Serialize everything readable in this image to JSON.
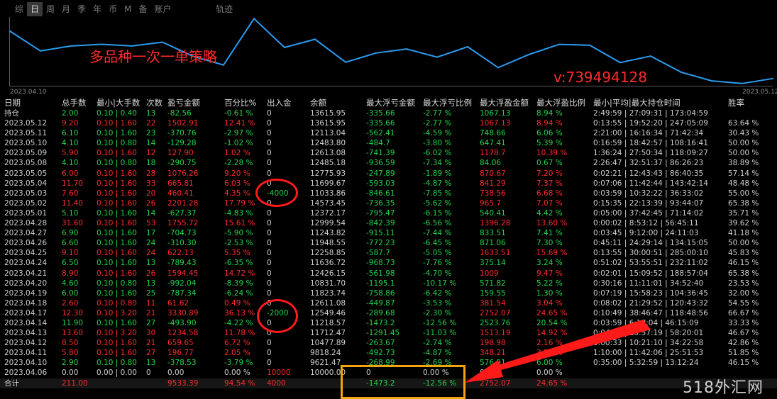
{
  "tabs": [
    "综",
    "日",
    "周",
    "月",
    "季",
    "年",
    "币",
    "M",
    "备",
    "账户"
  ],
  "active_tab": "日",
  "track_tab": "轨迹",
  "chart": {
    "start_date": "2023.04.10",
    "end_date": "2023.05.12",
    "strategy_title": "多品种一次一单策略",
    "contact": "v:739494128",
    "line_color": "#2a9bf0"
  },
  "chart_data": {
    "type": "line",
    "title": "",
    "xlabel": "",
    "ylabel": "",
    "x": [
      "2023.04.06",
      "2023.04.10",
      "2023.04.11",
      "2023.04.12",
      "2023.04.13",
      "2023.04.14",
      "2023.04.17",
      "2023.04.18",
      "2023.04.19",
      "2023.04.20",
      "2023.04.21",
      "2023.04.24",
      "2023.04.25",
      "2023.04.26",
      "2023.04.27",
      "2023.04.28",
      "2023.05.01",
      "2023.05.02",
      "2023.05.03",
      "2023.05.04",
      "2023.05.05",
      "2023.05.08",
      "2023.05.09",
      "2023.05.10",
      "2023.05.11",
      "2023.05.12",
      "持仓"
    ],
    "series": [
      {
        "values": [
          10000.0,
          9621.47,
          9818.24,
          10477.89,
          11712.47,
          11218.57,
          12549.46,
          12611.08,
          11823.74,
          10831.7,
          12426.15,
          11636.72,
          12258.85,
          11948.55,
          11243.82,
          12999.54,
          12372.17,
          14573.45,
          11033.86,
          11699.67,
          12775.93,
          12485.18,
          12613.08,
          12483.8,
          12113.04,
          13615.95,
          13615.95
        ]
      }
    ]
  },
  "columns": [
    "日期",
    "总手数",
    "最小|大手数",
    "次数",
    "盈亏金额",
    "百分比%",
    "出入金",
    "余额",
    "最大浮亏金额",
    "最大浮亏比例",
    "最大浮盈金额",
    "最大浮盈比例",
    "最小|平均|最大持仓时间",
    "胜率"
  ],
  "rows": [
    {
      "date": "持仓",
      "lots": "2.00",
      "minmax": "0.10 | 0.40",
      "count": "13",
      "pnl": "-82.56",
      "pct": "-0.61 %",
      "io": "0",
      "balance": "13615.95",
      "mfl": "-335.66",
      "mflp": "-2.77 %",
      "mfp": "1067.13",
      "mfpp": "8.94 %",
      "hold": "2:49:59 | 27:09:31 | 173:04:59",
      "win": "",
      "sign": "neg"
    },
    {
      "date": "2023.05.12",
      "lots": "9.20",
      "minmax": "0.10 | 1.60",
      "count": "22",
      "pnl": "1502.91",
      "pct": "12.41 %",
      "io": "0",
      "balance": "13615.95",
      "mfl": "-335.66",
      "mflp": "-2.77 %",
      "mfp": "1067.13",
      "mfpp": "8.94 %",
      "hold": "0:13:55 | 19:52:20 | 247:05:09",
      "win": "63.64 %",
      "sign": "pos"
    },
    {
      "date": "2023.05.11",
      "lots": "6.10",
      "minmax": "0.10 | 1.60",
      "count": "23",
      "pnl": "-370.76",
      "pct": "-2.97 %",
      "io": "0",
      "balance": "12113.04",
      "mfl": "-562.41",
      "mflp": "-4.59 %",
      "mfp": "748.66",
      "mfpp": "6.06 %",
      "hold": "2:21:00 | 16:16:34 | 71:42:34",
      "win": "30.43 %",
      "sign": "neg"
    },
    {
      "date": "2023.05.10",
      "lots": "4.10",
      "minmax": "0.10 | 0.80",
      "count": "14",
      "pnl": "-129.28",
      "pct": "-1.02 %",
      "io": "0",
      "balance": "12483.80",
      "mfl": "-484.7",
      "mflp": "-3.80 %",
      "mfp": "647.41",
      "mfpp": "5.39 %",
      "hold": "0:16:59 | 18:42:57 | 108:16:41",
      "win": "50.00 %",
      "sign": "neg"
    },
    {
      "date": "2023.05.09",
      "lots": "5.90",
      "minmax": "0.10 | 1.60",
      "count": "12",
      "pnl": "127.90",
      "pct": "1.02 %",
      "io": "0",
      "balance": "12613.08",
      "mfl": "-741.39",
      "mflp": "-6.02 %",
      "mfp": "1178.7",
      "mfpp": "10.39 %",
      "hold": "1:36:24 | 27:50:34 | 118:09:27",
      "win": "50.00 %",
      "sign": "pos"
    },
    {
      "date": "2023.05.08",
      "lots": "4.10",
      "minmax": "0.10 | 0.80",
      "count": "18",
      "pnl": "-290.75",
      "pct": "-2.28 %",
      "io": "0",
      "balance": "12485.18",
      "mfl": "-936.59",
      "mflp": "-7.34 %",
      "mfp": "84.06",
      "mfpp": "0.67 %",
      "hold": "2:26:47 | 32:51:37 | 86:26:23",
      "win": "38.89 %",
      "sign": "neg"
    },
    {
      "date": "2023.05.05",
      "lots": "6.00",
      "minmax": "0.10 | 1.60",
      "count": "28",
      "pnl": "1076.26",
      "pct": "9.20 %",
      "io": "0",
      "balance": "12775.93",
      "mfl": "-247.89",
      "mflp": "-1.89 %",
      "mfp": "870.67",
      "mfpp": "7.20 %",
      "hold": "0:02:21 | 12:43:43 | 86:40:35",
      "win": "57.14 %",
      "sign": "pos"
    },
    {
      "date": "2023.05.04",
      "lots": "11.70",
      "minmax": "0.10 | 1.60",
      "count": "33",
      "pnl": "665.81",
      "pct": "6.03 %",
      "io": "0",
      "balance": "11699.67",
      "mfl": "-593.03",
      "mflp": "-4.87 %",
      "mfp": "841.29",
      "mfpp": "7.37 %",
      "hold": "0:07:06 | 11:42:44 | 143:42:14",
      "win": "48.48 %",
      "sign": "pos"
    },
    {
      "date": "2023.05.03",
      "lots": "7.60",
      "minmax": "0.10 | 1.60",
      "count": "20",
      "pnl": "460.41",
      "pct": "4.35 %",
      "io": "-4000",
      "balance": "11033.86",
      "mfl": "-846.61",
      "mflp": "-7.85 %",
      "mfp": "738.56",
      "mfpp": "6.68 %",
      "hold": "0:03:59 | 10:32:22 | 36:33:02",
      "win": "55.00 %",
      "sign": "pos"
    },
    {
      "date": "2023.05.02",
      "lots": "11.40",
      "minmax": "0.10 | 1.60",
      "count": "26",
      "pnl": "2201.28",
      "pct": "17.79 %",
      "io": "0",
      "balance": "14573.45",
      "mfl": "-736.35",
      "mflp": "-5.62 %",
      "mfp": "965.7",
      "mfpp": "7.07 %",
      "hold": "0:15:35 | 22:13:39 | 93:44:07",
      "win": "65.38 %",
      "sign": "pos"
    },
    {
      "date": "2023.05.01",
      "lots": "5.10",
      "minmax": "0.10 | 1.60",
      "count": "14",
      "pnl": "-627.37",
      "pct": "-4.83 %",
      "io": "0",
      "balance": "12372.17",
      "mfl": "-795.47",
      "mflp": "-6.15 %",
      "mfp": "540.41",
      "mfpp": "4.42 %",
      "hold": "0:05:00 | 37:42:45 | 71:14:02",
      "win": "35.71 %",
      "sign": "neg"
    },
    {
      "date": "2023.04.28",
      "lots": "31.60",
      "minmax": "0.10 | 1.60",
      "count": "53",
      "pnl": "1755.72",
      "pct": "15.61 %",
      "io": "0",
      "balance": "12999.54",
      "mfl": "-842.39",
      "mflp": "-6.56 %",
      "mfp": "1396.28",
      "mfpp": "13.60 %",
      "hold": "0:00:02 | 8:53:12 | 56:45:11",
      "win": "39.62 %",
      "sign": "pos"
    },
    {
      "date": "2023.04.27",
      "lots": "6.90",
      "minmax": "0.10 | 1.60",
      "count": "17",
      "pnl": "-704.73",
      "pct": "-5.90 %",
      "io": "0",
      "balance": "11243.82",
      "mfl": "-915.11",
      "mflp": "-7.44 %",
      "mfp": "833.51",
      "mfpp": "7.41 %",
      "hold": "0:03:45 | 9:12:00 | 24:11:03",
      "win": "41.18 %",
      "sign": "neg"
    },
    {
      "date": "2023.04.26",
      "lots": "6.60",
      "minmax": "0.10 | 1.60",
      "count": "24",
      "pnl": "-310.30",
      "pct": "-2.53 %",
      "io": "0",
      "balance": "11948.55",
      "mfl": "-772.23",
      "mflp": "-6.45 %",
      "mfp": "871.06",
      "mfpp": "7.30 %",
      "hold": "0:45:11 | 24:29:14 | 134:15:05",
      "win": "50.00 %",
      "sign": "neg"
    },
    {
      "date": "2023.04.25",
      "lots": "9.10",
      "minmax": "0.10 | 1.60",
      "count": "24",
      "pnl": "622.13",
      "pct": "5.35 %",
      "io": "0",
      "balance": "12258.85",
      "mfl": "-587.7",
      "mflp": "-5.05 %",
      "mfp": "1633.51",
      "mfpp": "15.69 %",
      "hold": "0:13:55 | 30:00:51 | 285:00:10",
      "win": "45.83 %",
      "sign": "pos"
    },
    {
      "date": "2023.04.24",
      "lots": "6.50",
      "minmax": "0.10 | 1.60",
      "count": "13",
      "pnl": "-789.43",
      "pct": "-6.35 %",
      "io": "0",
      "balance": "11636.72",
      "mfl": "-968.73",
      "mflp": "-7.76 %",
      "mfp": "375.14",
      "mfpp": "3.24 %",
      "hold": "0:51:02 | 53:55:51 | 232:11:02",
      "win": "46.15 %",
      "sign": "neg"
    },
    {
      "date": "2023.04.21",
      "lots": "8.90",
      "minmax": "0.10 | 1.60",
      "count": "26",
      "pnl": "1594.45",
      "pct": "14.72 %",
      "io": "0",
      "balance": "12426.15",
      "mfl": "-561.98",
      "mflp": "-4.70 %",
      "mfp": "1009",
      "mfpp": "9.47 %",
      "hold": "0:02:01 | 15:09:52 | 188:57:04",
      "win": "65.38 %",
      "sign": "pos"
    },
    {
      "date": "2023.04.20",
      "lots": "4.60",
      "minmax": "0.10 | 0.80",
      "count": "13",
      "pnl": "-992.04",
      "pct": "-8.39 %",
      "io": "0",
      "balance": "10831.70",
      "mfl": "-1195.1",
      "mflp": "-10.17 %",
      "mfp": "571.82",
      "mfpp": "5.22 %",
      "hold": "0:30:16 | 11:11:01 | 34:52:40",
      "win": "23.53 %",
      "sign": "neg"
    },
    {
      "date": "2023.04.19",
      "lots": "6.00",
      "minmax": "0.10 | 1.60",
      "count": "25",
      "pnl": "-787.34",
      "pct": "-6.24 %",
      "io": "0",
      "balance": "11823.74",
      "mfl": "-758.86",
      "mflp": "-6.42 %",
      "mfp": "159.55",
      "mfpp": "1.30 %",
      "hold": "0:07:19 | 15:58:23 | 104:36:45",
      "win": "32.00 %",
      "sign": "neg"
    },
    {
      "date": "2023.04.18",
      "lots": "2.60",
      "minmax": "0.10 | 0.80",
      "count": "11",
      "pnl": "61.62",
      "pct": "0.49 %",
      "io": "0",
      "balance": "12611.08",
      "mfl": "-449.87",
      "mflp": "-3.53 %",
      "mfp": "381.54",
      "mfpp": "3.04 %",
      "hold": "0:08:02 | 21:29:52 | 120:43:32",
      "win": "54.55 %",
      "sign": "pos"
    },
    {
      "date": "2023.04.17",
      "lots": "12.30",
      "minmax": "0.10 | 3.20",
      "count": "21",
      "pnl": "3330.89",
      "pct": "36.13 %",
      "io": "-2000",
      "balance": "12549.46",
      "mfl": "-289.68",
      "mflp": "-2.30 %",
      "mfp": "2752.07",
      "mfpp": "24.65 %",
      "hold": "0:10:49 | 38:46:47 | 118:48:56",
      "win": "66.67 %",
      "sign": "pos"
    },
    {
      "date": "2023.04.14",
      "lots": "11.90",
      "minmax": "0.10 | 1.60",
      "count": "27",
      "pnl": "-493.90",
      "pct": "-4.22 %",
      "io": "0",
      "balance": "11218.57",
      "mfl": "-1473.2",
      "mflp": "-12.56 %",
      "mfp": "2523.76",
      "mfpp": "20.54 %",
      "hold": "0:03:59 | 6:18:04 | 46:15:09",
      "win": "33.33 %",
      "sign": "neg"
    },
    {
      "date": "2023.04.13",
      "lots": "13.60",
      "minmax": "0.10 | 3.20",
      "count": "30",
      "pnl": "1234.58",
      "pct": "11.78 %",
      "io": "0",
      "balance": "11712.47",
      "mfl": "-1291.45",
      "mflp": "-11.03 %",
      "mfp": "1513.19",
      "mfpp": "14.92 %",
      "hold": "0:04:45 | 13:57:19 | 58:20:01",
      "win": "46.67 %",
      "sign": "pos"
    },
    {
      "date": "2023.04.12",
      "lots": "8.50",
      "minmax": "0.10 | 1.60",
      "count": "21",
      "pnl": "659.65",
      "pct": "6.72 %",
      "io": "0",
      "balance": "10477.89",
      "mfl": "-263.67",
      "mflp": "-2.74 %",
      "mfp": "198.98",
      "mfpp": "2.16 %",
      "hold": "0:00:33 | 10:21:10 | 34:22:58",
      "win": "42.86 %",
      "sign": "pos"
    },
    {
      "date": "2023.04.11",
      "lots": "5.80",
      "minmax": "0.10 | 1.60",
      "count": "27",
      "pnl": "196.77",
      "pct": "2.05 %",
      "io": "0",
      "balance": "9818.24",
      "mfl": "-492.73",
      "mflp": "-4.87 %",
      "mfp": "348.21",
      "mfpp": "3.55 %",
      "hold": "1:10:00 | 11:42:06 | 25:51:53",
      "win": "51.85 %",
      "sign": "pos"
    },
    {
      "date": "2023.04.10",
      "lots": "2.90",
      "minmax": "0.10 | 0.80",
      "count": "13",
      "pnl": "-378.53",
      "pct": "-3.79 %",
      "io": "0",
      "balance": "9621.47",
      "mfl": "-268.99",
      "mflp": "-2.69 %",
      "mfp": "576.91",
      "mfpp": "6.00 %",
      "hold": "0:35:00 | 5:32:59 | 13:12:24",
      "win": "46.15 %",
      "sign": "neg"
    },
    {
      "date": "2023.04.06",
      "lots": "0.00",
      "minmax": "0.00 | 0.00",
      "count": "0",
      "pnl": "0.00",
      "pct": "0.00 %",
      "io": "10000",
      "balance": "10000.00",
      "mfl": "0",
      "mflp": "0.00 %",
      "mfp": "0",
      "mfpp": "0.00 %",
      "hold": "",
      "win": "",
      "sign": "zero"
    }
  ],
  "total": {
    "date": "合计",
    "lots": "211.00",
    "pnl": "9533.39",
    "pct": "94.54 %",
    "io": "4000",
    "mfl": "-1473.2",
    "mflp": "-12.56 %",
    "mfp": "2752.07",
    "mfpp": "24.65 %"
  },
  "watermark": "518外汇网",
  "colors": {
    "profit": "#ff2a2a",
    "loss": "#22d34a",
    "circle": "#ff1a1a",
    "box": "#f5a50b"
  }
}
